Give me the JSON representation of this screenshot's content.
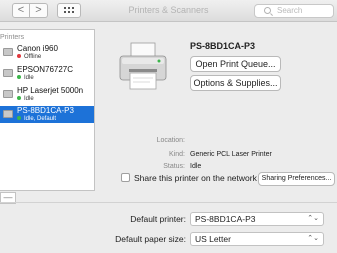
{
  "window": {
    "title": "Printers & Scanners"
  },
  "toolbar": {
    "back": "<",
    "forward": ">",
    "search_placeholder": "Search"
  },
  "colors": {
    "selection": "#1d72d8",
    "status_offline": "#e0383e",
    "status_idle": "#3cb54a"
  },
  "printer_list": {
    "header": "Printers",
    "items": [
      {
        "name": "Canon i960",
        "status": "Offline",
        "status_color": "#e0383e"
      },
      {
        "name": "EPSON76727C",
        "status": "Idle",
        "status_color": "#3cb54a"
      },
      {
        "name": "HP Laserjet 5000n",
        "status": "Idle",
        "status_color": "#3cb54a"
      },
      {
        "name": "PS-8BD1CA-P3",
        "status": "Idle, Default",
        "status_color": "#3cb54a",
        "selected": true
      }
    ],
    "remove_label": "—"
  },
  "detail": {
    "printer_name": "PS-8BD1CA-P3",
    "open_queue": "Open Print Queue...",
    "options": "Options & Supplies...",
    "location_label": "Location:",
    "location_value": "",
    "kind_label": "Kind:",
    "kind_value": "Generic PCL Laser Printer",
    "status_label": "Status:",
    "status_value": "Idle",
    "share_label": "Share this printer on the network",
    "share_checked": false,
    "sharing_prefs": "Sharing Preferences..."
  },
  "defaults": {
    "default_printer_label": "Default printer:",
    "default_printer_value": "PS-8BD1CA-P3",
    "paper_size_label": "Default paper size:",
    "paper_size_value": "US Letter"
  }
}
